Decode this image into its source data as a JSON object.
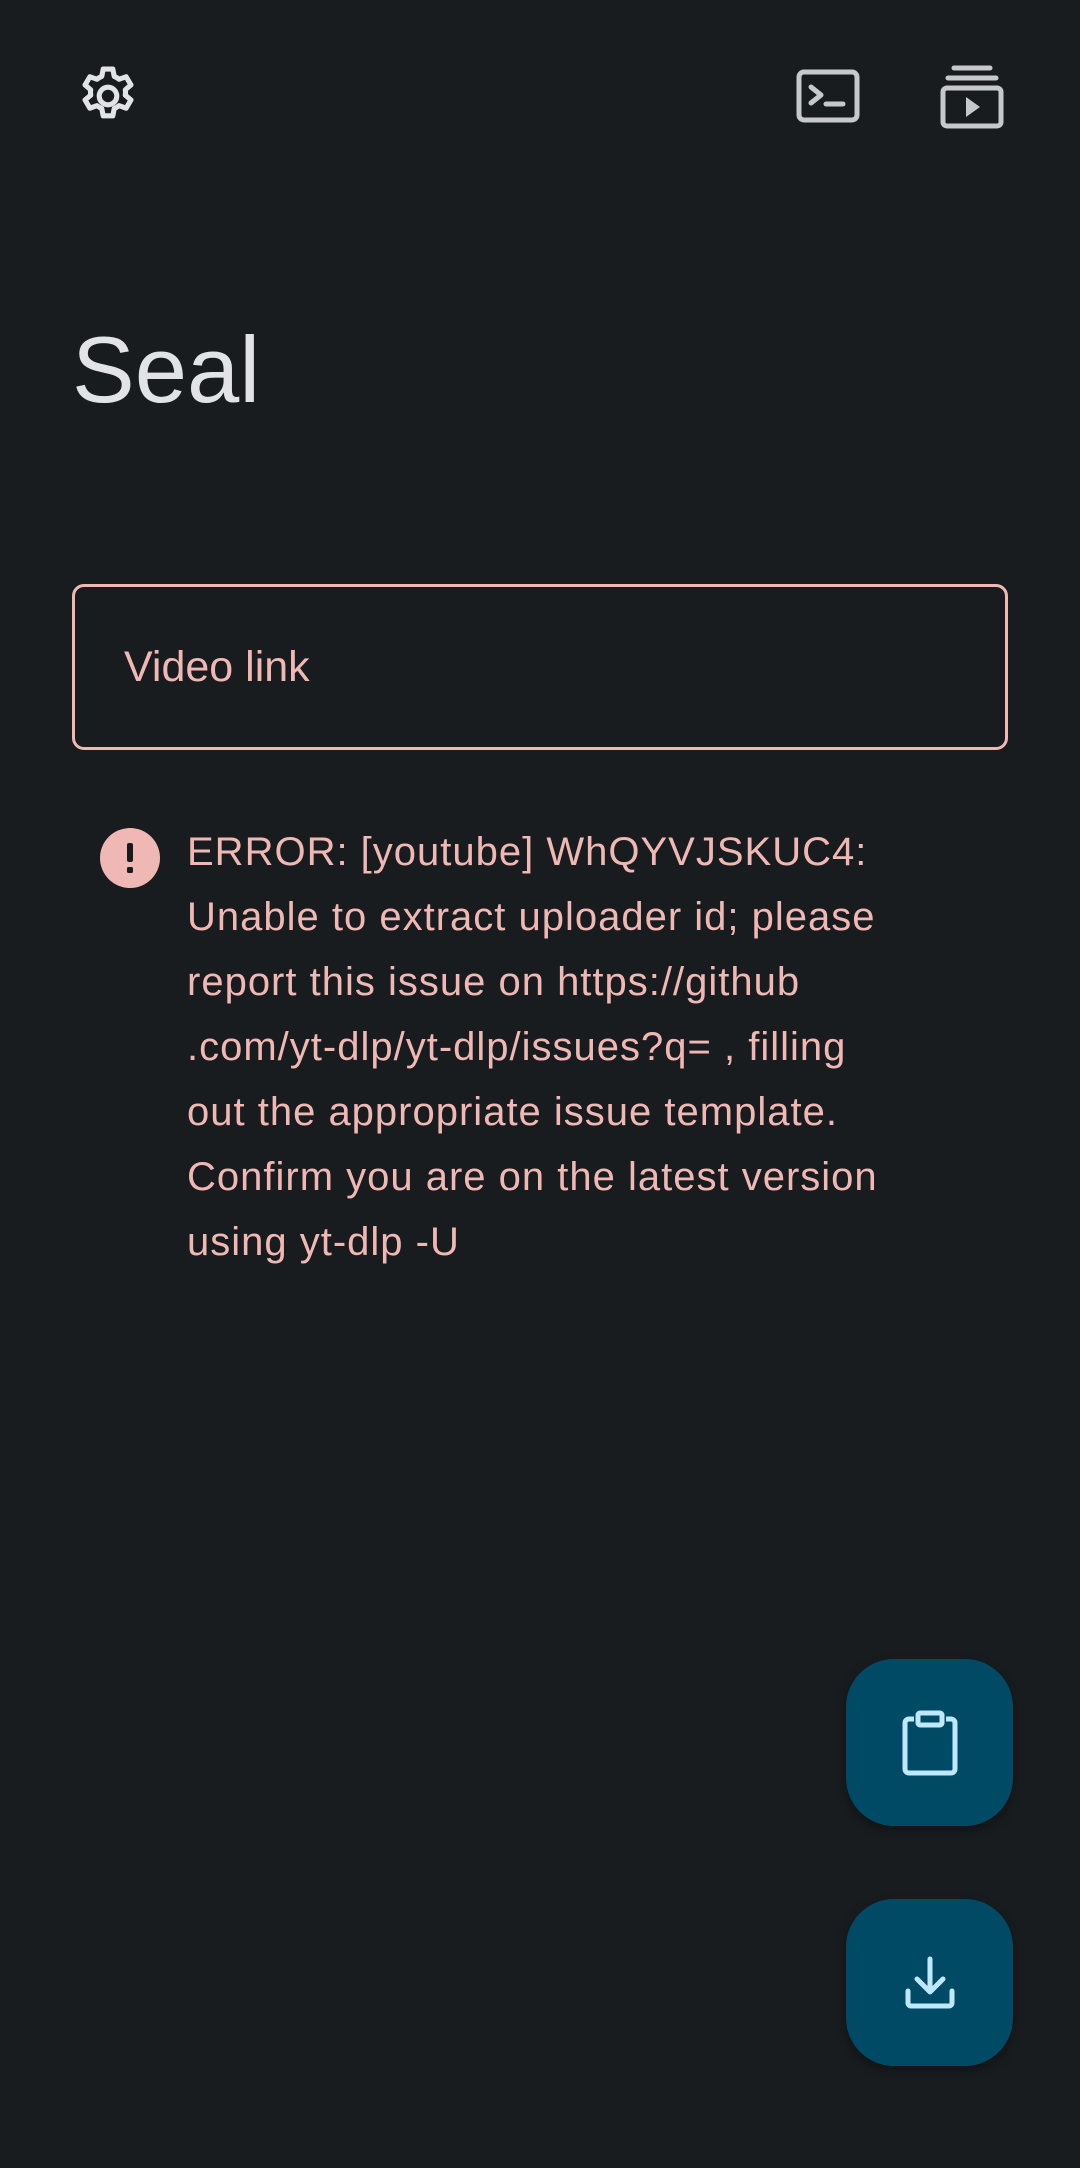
{
  "app": {
    "title": "Seal"
  },
  "toolbar": {
    "settings_icon": "gear-icon",
    "terminal_icon": "terminal-icon",
    "queue_icon": "video-queue-icon"
  },
  "input": {
    "placeholder": "Video link",
    "value": ""
  },
  "error": {
    "icon": "error-circle-icon",
    "message": "ERROR: [youtube] WhQYVJSKUC4:\nUnable to extract uploader id; please\nreport this issue on  https://github\n.com/yt-dlp/yt-dlp/issues?q= , filling\nout the appropriate issue template.\nConfirm you are on the latest version\nusing  yt-dlp -U"
  },
  "fabs": {
    "paste_icon": "clipboard-icon",
    "download_icon": "download-icon"
  },
  "colors": {
    "background": "#191c1f",
    "title": "#e2e3e6",
    "accent_error": "#f0b8b4",
    "fab_background": "#004a66",
    "fab_icon": "#bfe8ff",
    "toolbar_icon": "#c6c8cc"
  }
}
